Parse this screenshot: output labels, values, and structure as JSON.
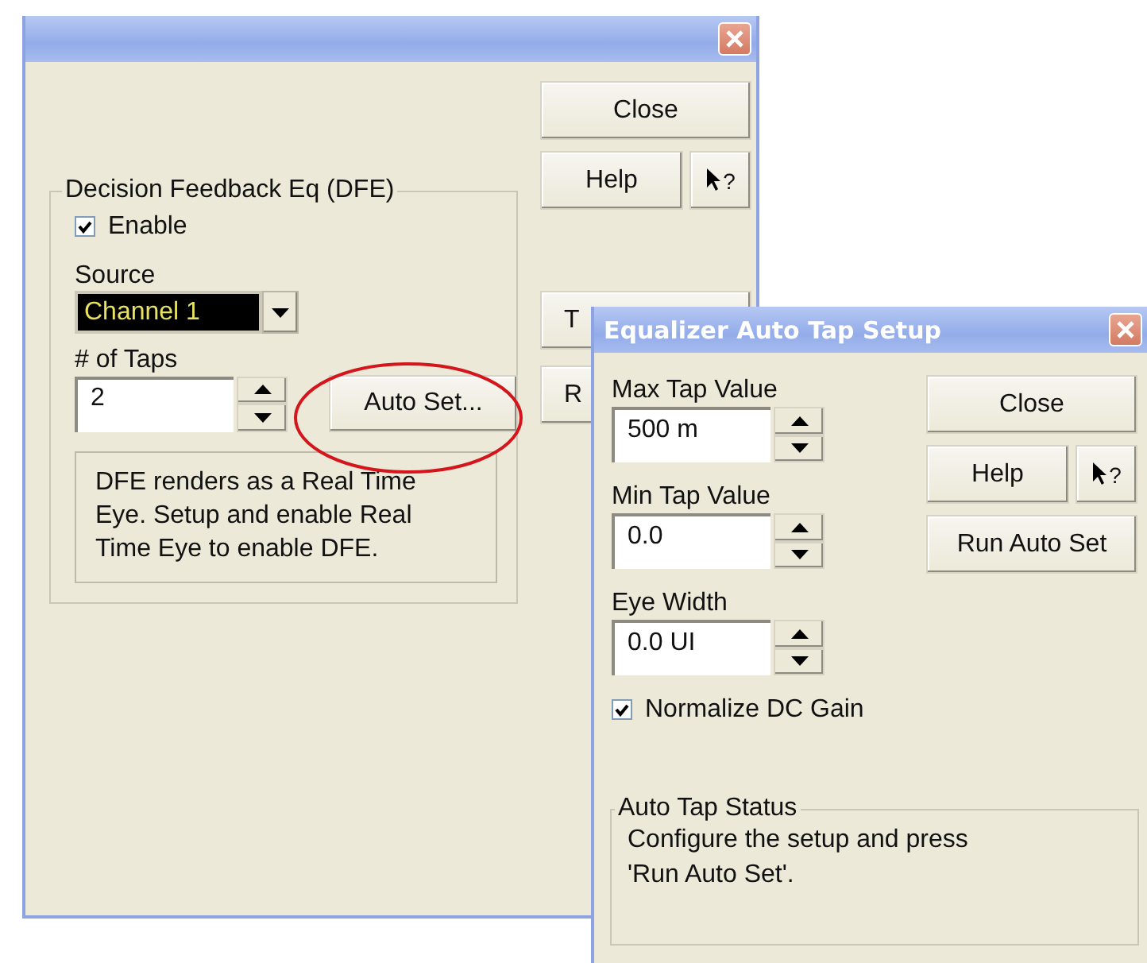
{
  "main_window": {
    "buttons": [
      {
        "kind": "wide",
        "label": "Close"
      },
      {
        "kind": "help",
        "label": "Help",
        "context_help": "?"
      },
      {
        "kind": "partial",
        "label": "T"
      },
      {
        "kind": "partial",
        "label": "R"
      }
    ],
    "dfe": {
      "title": "Decision Feedback Eq (DFE)",
      "enable": {
        "label": "Enable",
        "checked": true
      },
      "source": {
        "label": "Source",
        "value": "Channel 1"
      },
      "taps": {
        "label": "# of Taps",
        "value": "2"
      },
      "auto_set": "Auto Set...",
      "note": "DFE renders as a Real Time Eye. Setup and enable Real Time Eye to enable DFE."
    }
  },
  "auto_tap_window": {
    "title": "Equalizer Auto Tap Setup",
    "fields": [
      {
        "label": "Max Tap Value",
        "value": "500 m"
      },
      {
        "label": "Min Tap Value",
        "value": "0.0"
      },
      {
        "label": "Eye Width",
        "value": "0.0 UI"
      }
    ],
    "normalize": {
      "label": "Normalize DC Gain",
      "checked": true
    },
    "buttons": [
      {
        "kind": "wide",
        "label": "Close"
      },
      {
        "kind": "help",
        "label": "Help",
        "context_help": "?"
      },
      {
        "kind": "wide",
        "label": "Run Auto Set"
      }
    ],
    "status": {
      "title": "Auto Tap Status",
      "text": "Configure the setup and press 'Run Auto Set'."
    }
  }
}
